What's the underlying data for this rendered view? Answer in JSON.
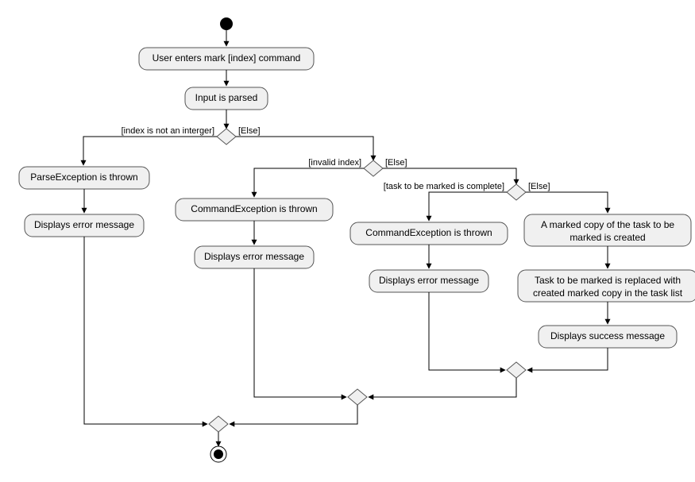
{
  "chart_data": {
    "type": "activity-diagram",
    "nodes": {
      "start": {
        "kind": "initial"
      },
      "n1": {
        "kind": "action",
        "label": "User enters mark [index] command"
      },
      "n2": {
        "kind": "action",
        "label": "Input is parsed"
      },
      "d1": {
        "kind": "decision"
      },
      "n3": {
        "kind": "action",
        "label": "ParseException is thrown"
      },
      "n4": {
        "kind": "action",
        "label": "Displays error message"
      },
      "d2": {
        "kind": "decision"
      },
      "n5": {
        "kind": "action",
        "label": "CommandException is thrown"
      },
      "n6": {
        "kind": "action",
        "label": "Displays error message"
      },
      "d3": {
        "kind": "decision"
      },
      "n7": {
        "kind": "action",
        "label": "CommandException is thrown"
      },
      "n8": {
        "kind": "action",
        "label": "Displays error message"
      },
      "n9": {
        "kind": "action",
        "label": "A marked copy of the task to be marked is created"
      },
      "n10": {
        "kind": "action",
        "label": "Task to be marked is replaced with created marked copy in the task list"
      },
      "n11": {
        "kind": "action",
        "label": "Displays success message"
      },
      "m3": {
        "kind": "merge"
      },
      "m2": {
        "kind": "merge"
      },
      "m1": {
        "kind": "merge"
      },
      "end": {
        "kind": "final"
      }
    },
    "edges": [
      {
        "from": "start",
        "to": "n1"
      },
      {
        "from": "n1",
        "to": "n2"
      },
      {
        "from": "n2",
        "to": "d1"
      },
      {
        "from": "d1",
        "to": "n3",
        "guard": "[index is not an interger]"
      },
      {
        "from": "d1",
        "to": "d2",
        "guard": "[Else]"
      },
      {
        "from": "n3",
        "to": "n4"
      },
      {
        "from": "d2",
        "to": "n5",
        "guard": "[invalid index]"
      },
      {
        "from": "d2",
        "to": "d3",
        "guard": "[Else]"
      },
      {
        "from": "n5",
        "to": "n6"
      },
      {
        "from": "d3",
        "to": "n7",
        "guard": "[task to be marked is complete]"
      },
      {
        "from": "d3",
        "to": "n9",
        "guard": "[Else]"
      },
      {
        "from": "n7",
        "to": "n8"
      },
      {
        "from": "n9",
        "to": "n10"
      },
      {
        "from": "n10",
        "to": "n11"
      },
      {
        "from": "n8",
        "to": "m3"
      },
      {
        "from": "n11",
        "to": "m3"
      },
      {
        "from": "n6",
        "to": "m2"
      },
      {
        "from": "m3",
        "to": "m2"
      },
      {
        "from": "n4",
        "to": "m1"
      },
      {
        "from": "m2",
        "to": "m1"
      },
      {
        "from": "m1",
        "to": "end"
      }
    ]
  },
  "guards": {
    "g1a": "[index is not an interger]",
    "g1b": "[Else]",
    "g2a": "[invalid index]",
    "g2b": "[Else]",
    "g3a": "[task to be marked is complete]",
    "g3b": "[Else]"
  },
  "labels": {
    "n1": "User enters mark [index] command",
    "n2": "Input is parsed",
    "n3": "ParseException is thrown",
    "n4": "Displays error message",
    "n5": "CommandException is thrown",
    "n6": "Displays error message",
    "n7": "CommandException is thrown",
    "n8": "Displays error message",
    "n9a": "A marked copy of the task to be",
    "n9b": "marked is created",
    "n10a": "Task to be marked is replaced with",
    "n10b": "created marked copy in the task list",
    "n11": "Displays success message"
  }
}
